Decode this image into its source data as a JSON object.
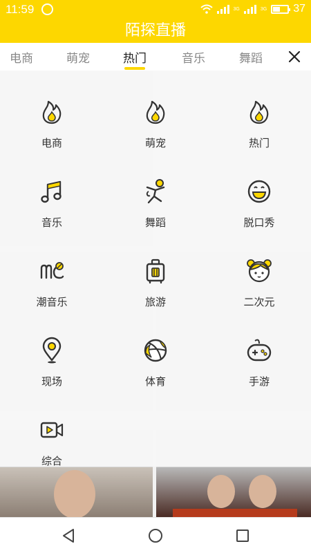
{
  "status": {
    "time": "11:59",
    "net1": "3G",
    "net2": "3G",
    "battery": "37"
  },
  "header": {
    "title": "陌探直播"
  },
  "tabs": [
    {
      "label": "电商"
    },
    {
      "label": "萌宠"
    },
    {
      "label": "热门"
    },
    {
      "label": "音乐"
    },
    {
      "label": "舞蹈"
    }
  ],
  "grid": [
    {
      "label": "电商",
      "icon": "flame-icon"
    },
    {
      "label": "萌宠",
      "icon": "flame-icon"
    },
    {
      "label": "热门",
      "icon": "flame-icon"
    },
    {
      "label": "音乐",
      "icon": "music-note-icon"
    },
    {
      "label": "舞蹈",
      "icon": "dancer-icon"
    },
    {
      "label": "脱口秀",
      "icon": "smiley-icon"
    },
    {
      "label": "潮音乐",
      "icon": "trend-music-icon"
    },
    {
      "label": "旅游",
      "icon": "suitcase-icon"
    },
    {
      "label": "二次元",
      "icon": "anime-girl-icon"
    },
    {
      "label": "现场",
      "icon": "location-pin-icon"
    },
    {
      "label": "体育",
      "icon": "basketball-icon"
    },
    {
      "label": "手游",
      "icon": "gamepad-icon"
    },
    {
      "label": "综合",
      "icon": "video-camera-icon"
    }
  ],
  "colors": {
    "accent": "#FDD700",
    "icon_stroke": "#333333",
    "icon_fill": "#FDD700"
  }
}
